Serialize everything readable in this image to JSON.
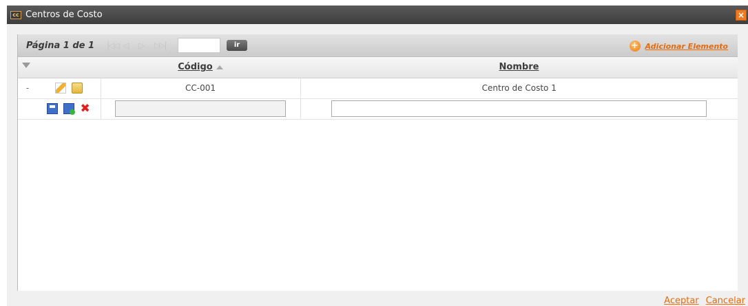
{
  "window": {
    "title": "Centros de Costo",
    "close_label": "×"
  },
  "pager": {
    "page_label": "Página 1 de 1",
    "nav": [
      "|◁◁",
      "◁",
      "▷",
      "▷▷|"
    ],
    "page_input_value": "",
    "go_label": "ir",
    "add_label": "Adicionar Elemento",
    "add_icon": "+"
  },
  "table": {
    "columns": [
      "Código",
      "Nombre"
    ],
    "rows": [
      {
        "marker": "-",
        "code": "CC-001",
        "name": "Centro de Costo 1"
      }
    ],
    "edit_row": {
      "code_value": "",
      "name_value": ""
    }
  },
  "icons": {
    "delete": "✖"
  },
  "footer": {
    "accept_label": "Aceptar",
    "cancel_label": "Cancelar"
  }
}
